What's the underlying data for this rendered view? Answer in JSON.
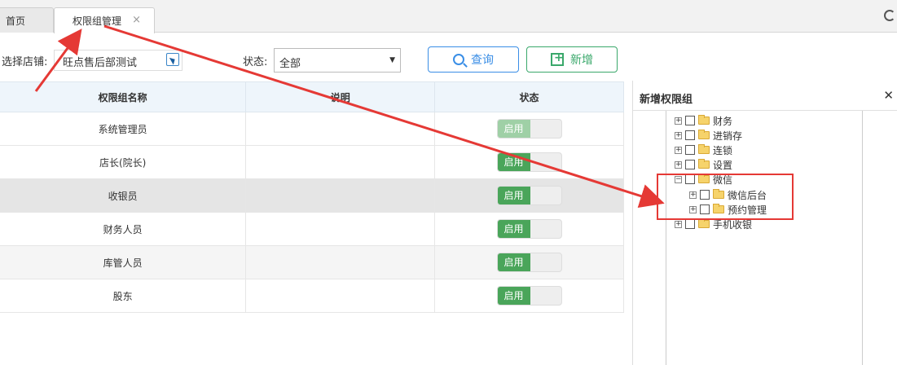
{
  "tabs": [
    {
      "label": "首页"
    },
    {
      "label": "权限组管理",
      "close": "×"
    }
  ],
  "filter": {
    "store_label": "选择店铺:",
    "store_value": "旺点售后部测试",
    "status_label": "状态:",
    "status_value": "全部",
    "query_label": "查询",
    "add_label": "新增"
  },
  "table": {
    "headers": [
      "权限组名称",
      "说明",
      "状态"
    ],
    "rows": [
      {
        "name": "系统管理员",
        "desc": "",
        "status": "启用"
      },
      {
        "name": "店长(院长)",
        "desc": "",
        "status": "启用"
      },
      {
        "name": "收银员",
        "desc": "",
        "status": "启用"
      },
      {
        "name": "财务人员",
        "desc": "",
        "status": "启用"
      },
      {
        "name": "库管人员",
        "desc": "",
        "status": "启用"
      },
      {
        "name": "股东",
        "desc": "",
        "status": "启用"
      }
    ]
  },
  "panel": {
    "title": "新增权限组",
    "close": "✕",
    "tree": [
      {
        "label": "财务"
      },
      {
        "label": "进销存"
      },
      {
        "label": "连锁"
      },
      {
        "label": "设置"
      },
      {
        "label": "微信"
      },
      {
        "label": "微信后台"
      },
      {
        "label": "预约管理"
      },
      {
        "label": "手机收银"
      }
    ]
  },
  "colors": {
    "accent_blue": "#3a8ee6",
    "accent_green": "#3aa86b",
    "annotation_red": "#e53935"
  }
}
